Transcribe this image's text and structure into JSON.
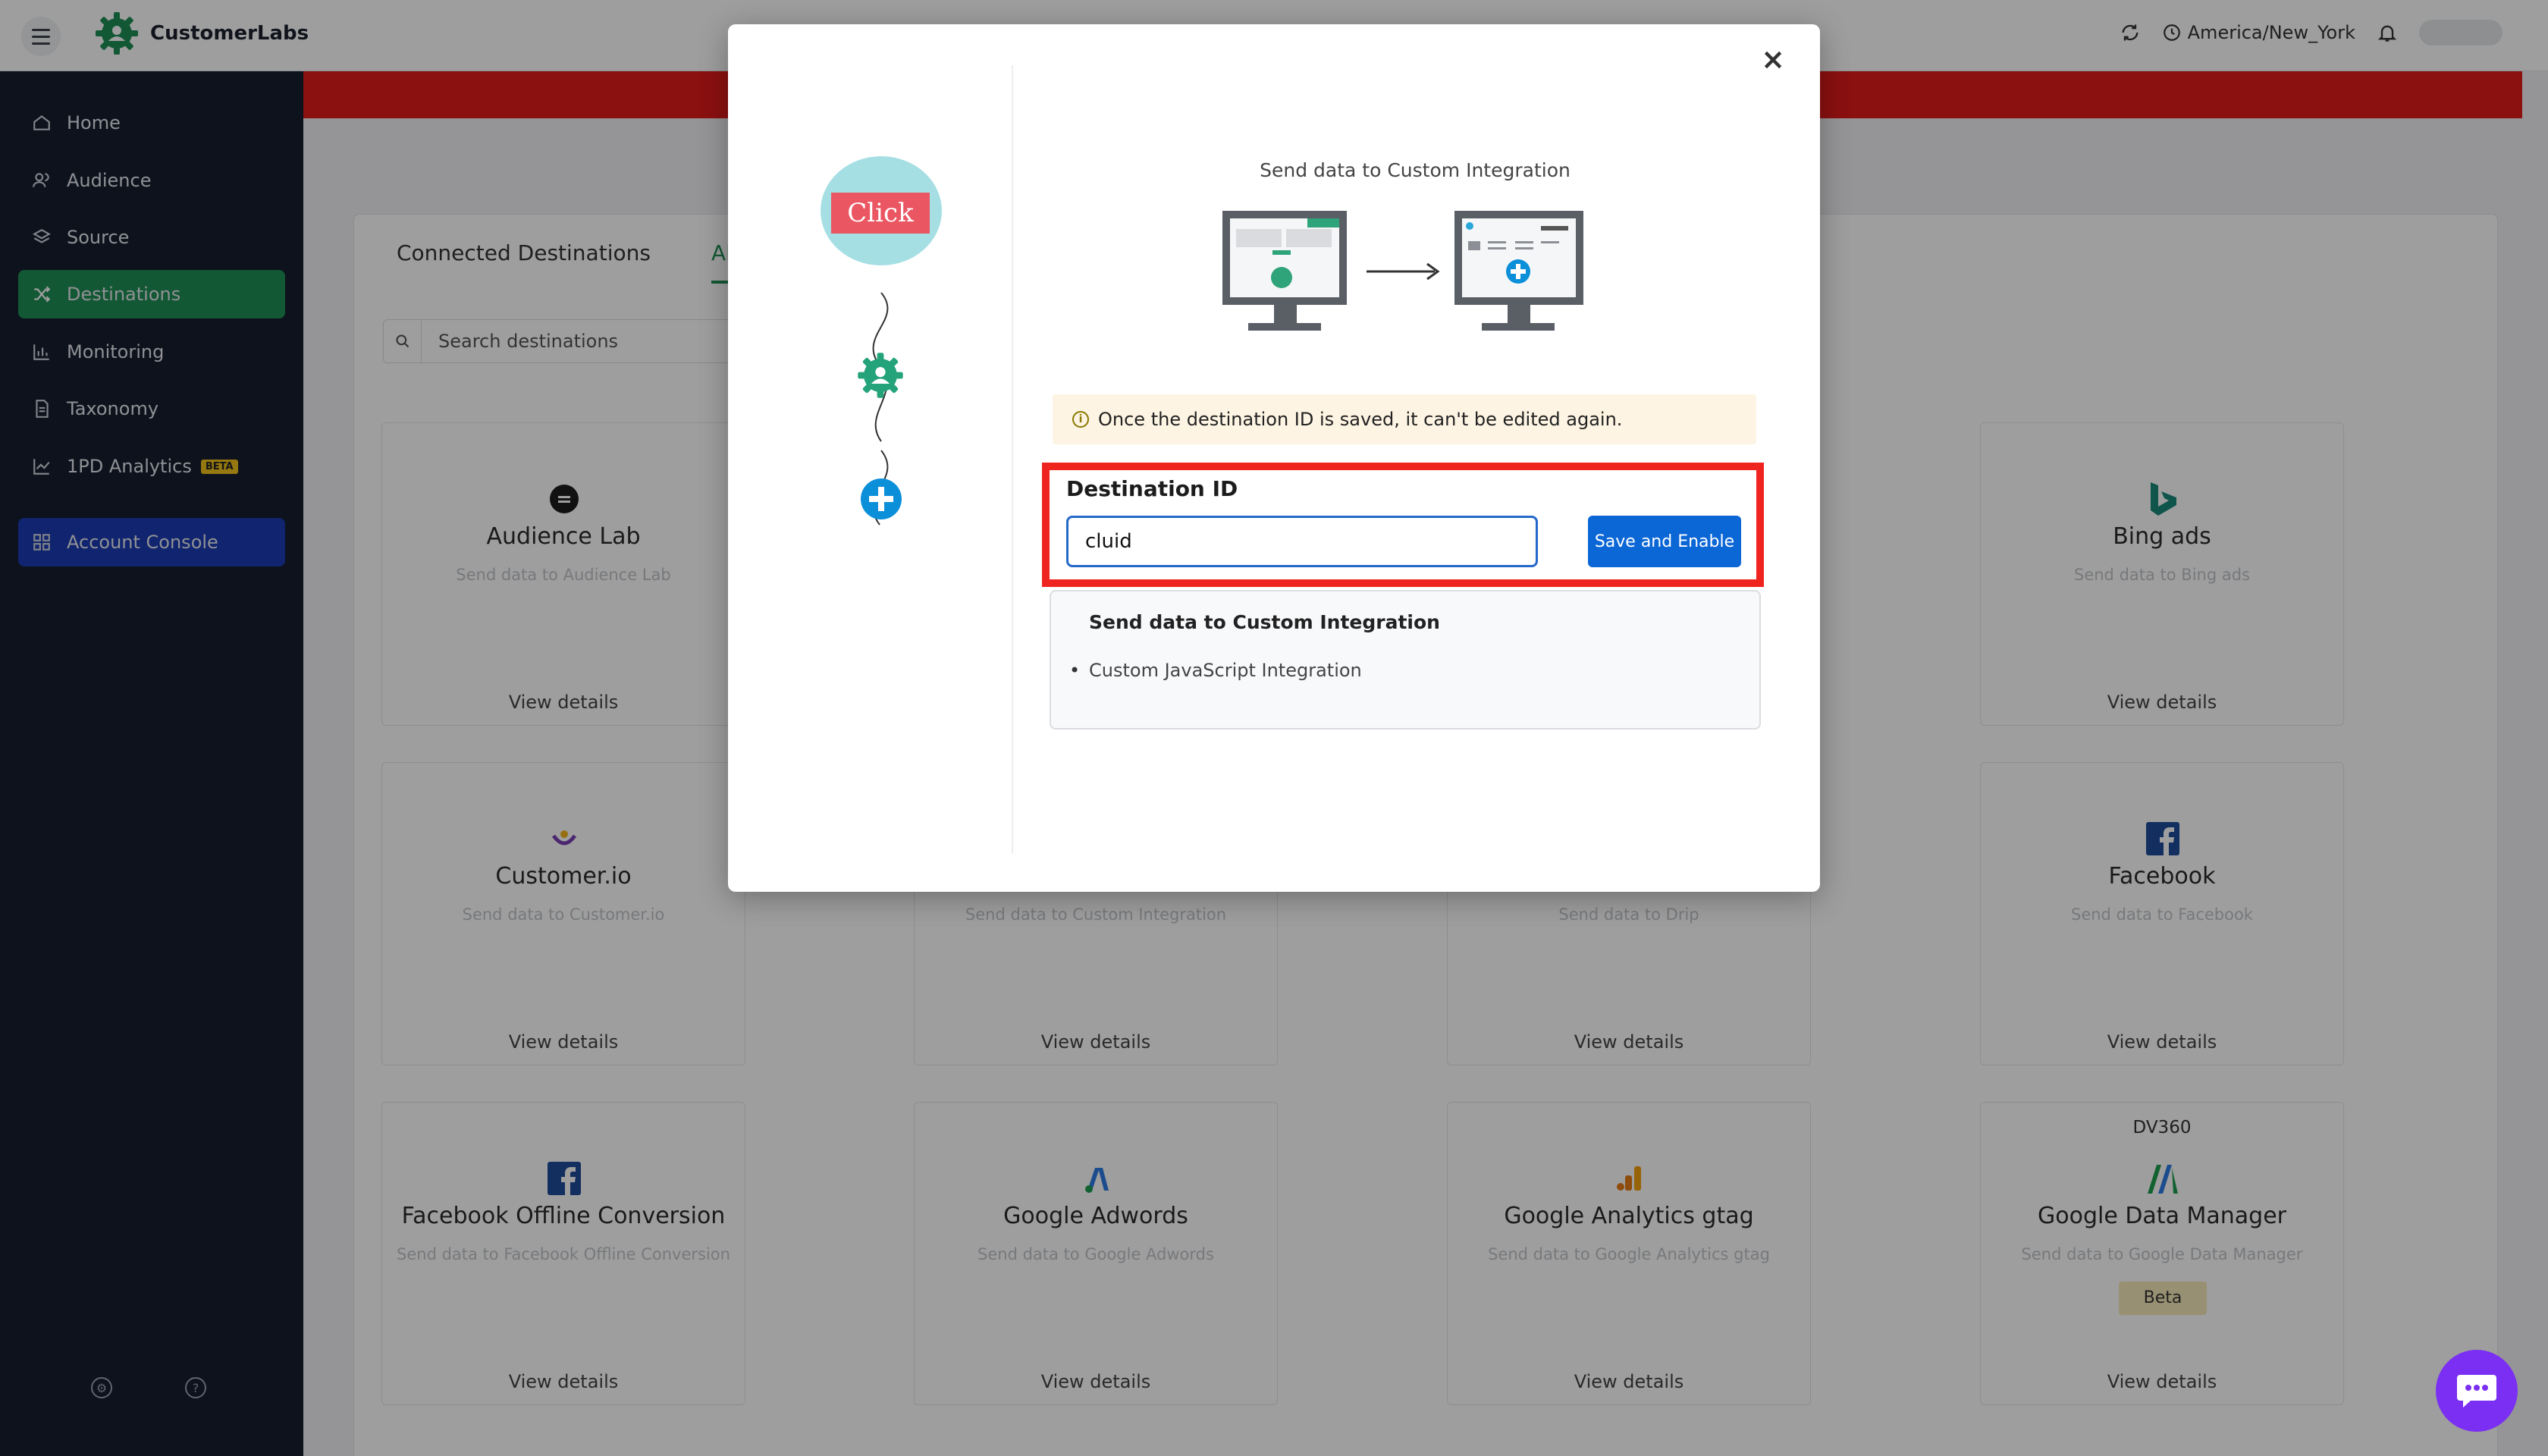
{
  "app": {
    "name": "CustomerLabs",
    "timezone": "America/New_York"
  },
  "sidebar": {
    "items": [
      {
        "label": "Home",
        "icon": "home-icon"
      },
      {
        "label": "Audience",
        "icon": "users-icon"
      },
      {
        "label": "Source",
        "icon": "layers-icon"
      },
      {
        "label": "Destinations",
        "icon": "shuffle-icon",
        "active": true
      },
      {
        "label": "Monitoring",
        "icon": "bar-chart-icon"
      },
      {
        "label": "Taxonomy",
        "icon": "document-icon"
      },
      {
        "label": "1PD Analytics",
        "icon": "trend-icon",
        "badge": "BETA"
      }
    ],
    "console": {
      "label": "Account Console",
      "icon": "grid-icon"
    }
  },
  "main": {
    "tabs": [
      {
        "label": "Connected Destinations",
        "active": false
      },
      {
        "label": "All",
        "active": true
      }
    ],
    "search_placeholder": "Search destinations",
    "cards": [
      {
        "name": "Audience Lab",
        "desc": "Send data to Audience Lab",
        "details": "View details"
      },
      {
        "name": "Bing ads",
        "desc": "Send data to Bing ads",
        "details": "View details"
      },
      {
        "name": "Customer.io",
        "desc": "Send data to Customer.io",
        "details": "View details"
      },
      {
        "name": "",
        "desc": "Send data to Custom Integration",
        "details": "View details"
      },
      {
        "name": "",
        "desc": "Send data to Drip",
        "details": "View details"
      },
      {
        "name": "Facebook",
        "desc": "Send data to Facebook",
        "details": "View details"
      },
      {
        "name": "Facebook Offline Conversion",
        "desc": "Send data to Facebook Offline Conversion",
        "details": "View details"
      },
      {
        "name": "Google Adwords",
        "desc": "Send data to Google Adwords",
        "details": "View details"
      },
      {
        "name": "Google Analytics gtag",
        "desc": "Send data to Google Analytics gtag",
        "details": "View details"
      },
      {
        "name": "Google Data Manager",
        "desc": "Send data to Google Data Manager",
        "details": "View details",
        "tag": "DV360",
        "badge": "Beta"
      }
    ]
  },
  "modal": {
    "click_label": "Click",
    "illustration_title": "Send data to Custom Integration",
    "notice": "Once the destination ID is saved, it can't be edited again.",
    "destination_id_label": "Destination ID",
    "destination_id_value": "cluid",
    "save_label": "Save and Enable",
    "info_title": "Send data to Custom Integration",
    "info_items": [
      "Custom JavaScript Integration"
    ],
    "close_symbol": "×"
  },
  "colors": {
    "sidebar_bg": "#151d2f",
    "active_green": "#1f8f54",
    "console_blue": "#1a3bb3",
    "banner_red": "#e11a1a",
    "highlight_red": "#f0241f",
    "primary_button": "#0b66d6",
    "chat_purple": "#7b2ff2"
  }
}
